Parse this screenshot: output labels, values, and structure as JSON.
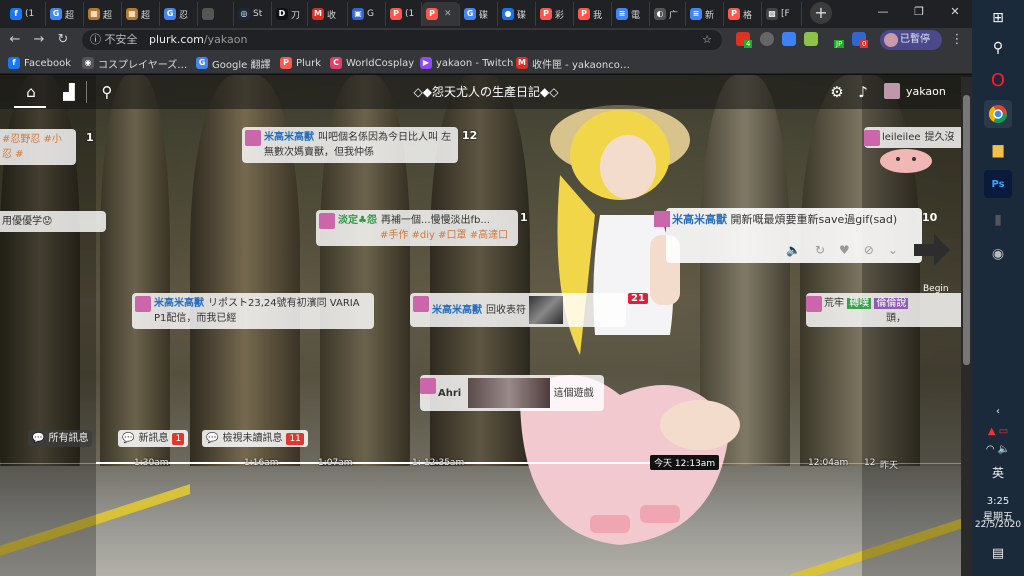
{
  "browser": {
    "tabs": [
      {
        "label": "(1",
        "fav": "f",
        "color": "#1877f2"
      },
      {
        "label": "超",
        "fav": "G",
        "color": "#4285f4"
      },
      {
        "label": "超",
        "fav": "▦",
        "color": "#b47a2e"
      },
      {
        "label": "超",
        "fav": "▦",
        "color": "#b47a2e"
      },
      {
        "label": "忍",
        "fav": "G",
        "color": "#4285f4"
      },
      {
        "label": "",
        "fav": "",
        "color": "#555"
      },
      {
        "label": "St",
        "fav": "◎",
        "color": "#1b2838"
      },
      {
        "label": "刀",
        "fav": "D",
        "color": "#111"
      },
      {
        "label": "收",
        "fav": "M",
        "color": "#d93025"
      },
      {
        "label": "G",
        "fav": "▣",
        "color": "#3367d6"
      },
      {
        "label": "(1",
        "fav": "P",
        "color": "#ff574d"
      },
      {
        "label": "",
        "fav": "P",
        "color": "#ff574d",
        "active": true
      },
      {
        "label": "碟",
        "fav": "G",
        "color": "#4285f4"
      },
      {
        "label": "碟",
        "fav": "●",
        "color": "#1a73e8"
      },
      {
        "label": "彩",
        "fav": "P",
        "color": "#ff574d"
      },
      {
        "label": "我",
        "fav": "P",
        "color": "#ff574d"
      },
      {
        "label": "電",
        "fav": "≡",
        "color": "#4285f4"
      },
      {
        "label": "广",
        "fav": "◐",
        "color": "#555"
      },
      {
        "label": "新",
        "fav": "≡",
        "color": "#4285f4"
      },
      {
        "label": "格",
        "fav": "P",
        "color": "#ff574d"
      },
      {
        "label": "[F",
        "fav": "▩",
        "color": "#444"
      }
    ],
    "new_tab": "+",
    "window_controls": {
      "minimize": "—",
      "restore": "❐",
      "close": "✕"
    },
    "security_label": "不安全",
    "url_host": "plurk.com",
    "url_path": "/yakaon",
    "profile_label": "已暫停",
    "extension_badges": [
      "4",
      "JP",
      "0"
    ],
    "bookmarks": [
      {
        "label": "Facebook",
        "fav": "f",
        "color": "#1877f2"
      },
      {
        "label": "コスプレイヤーズ…",
        "fav": "◉",
        "color": "#555"
      },
      {
        "label": "Google 翻譯",
        "fav": "G",
        "color": "#4285f4"
      },
      {
        "label": "Plurk",
        "fav": "P",
        "color": "#ff574d"
      },
      {
        "label": "WorldCosplay",
        "fav": "C",
        "color": "#e0406a"
      },
      {
        "label": "yakaon - Twitch",
        "fav": "▶",
        "color": "#9146ff"
      },
      {
        "label": "收件匣 - yakaonco…",
        "fav": "M",
        "color": "#d93025"
      }
    ]
  },
  "plurk": {
    "title": "◇◆怨天尤人の生產日記◆◇",
    "username": "yakaon",
    "posts": [
      {
        "owner": "米高米高獸",
        "text": "叫吧個名係因為今日比人叫 左無數次媽賣獸，但我仲係",
        "count": "12"
      },
      {
        "owner": "淡定♣怨",
        "text": "再補一個...慢慢淡出fb...",
        "tags": "#手作 #diy #口罩 #高達口",
        "count": "1"
      },
      {
        "owner": "米高米高獸",
        "text": "リポスト23,24號有初濱同 VARIA P1配信，而我已經"
      },
      {
        "owner": "米高米高獸",
        "text": "回收表符",
        "count": "21"
      },
      {
        "owner": "Ahri",
        "text": "這個遊戲"
      },
      {
        "owner": "米高米高獸",
        "text": "開新嘅最煩要重新save過gif(sad)",
        "count": "10"
      },
      {
        "owner": "leileilee",
        "text": "提久沒"
      },
      {
        "owner": "荒牢",
        "tag1": "轉噗",
        "tag2": "倫倫說",
        "text": "頭，"
      }
    ],
    "partial_left": [
      {
        "text": "#忍野忍 #小忍 #",
        "count": "1"
      },
      {
        "text": "用優優学😟"
      }
    ],
    "begin_label": "Begin",
    "filters": {
      "all": "所有訊息",
      "new": "新訊息",
      "new_badge": "1",
      "unread": "檢視未讀訊息",
      "unread_badge": "11"
    },
    "timeline": {
      "ticks": [
        "1:30am",
        "1:16am",
        "1:07am",
        "1:",
        "12:35am",
        "12:04am",
        "12",
        "昨天"
      ],
      "now_label": "今天 12:13am"
    }
  },
  "taskbar": {
    "clock_time": "3:25",
    "clock_day": "星期五",
    "clock_date": "22/5/2020",
    "ime": "英"
  }
}
